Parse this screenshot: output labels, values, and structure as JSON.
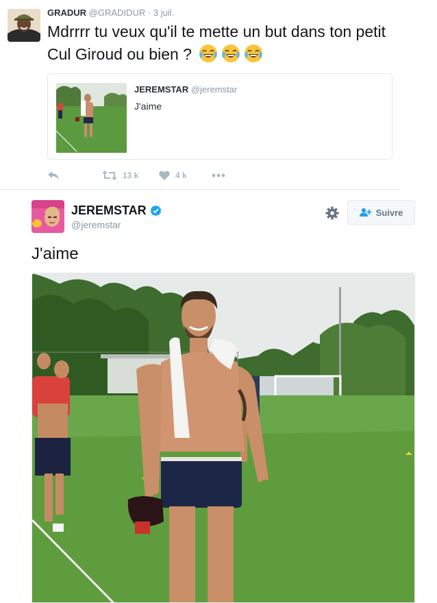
{
  "tweet": {
    "author_name": "GRADUR",
    "author_handle": "@GRADIDUR",
    "separator": "·",
    "time": "3 juil.",
    "text": "Mdrrrr tu veux qu'il te mette un but dans ton petit Cul Giroud ou bien ?",
    "emoji": [
      "face-with-tears-of-joy",
      "face-with-tears-of-joy",
      "face-with-tears-of-joy"
    ],
    "quoted": {
      "author_name": "JEREMSTAR",
      "author_handle": "@jeremstar",
      "text": "J'aime"
    },
    "actions": {
      "reply_icon": "reply-icon",
      "retweet_icon": "retweet-icon",
      "retweet_count": "13 k",
      "like_icon": "heart-icon",
      "like_count": "4 k",
      "more_icon": "more-icon"
    }
  },
  "main_tweet": {
    "author_name": "JEREMSTAR",
    "author_handle": "@jeremstar",
    "verified_icon": "verified-badge-icon",
    "follow_label": "Suivre",
    "gear_icon": "gear-icon",
    "text": "J'aime"
  },
  "colors": {
    "text": "#14171a",
    "muted": "#8899a6",
    "verified": "#1da1f2",
    "border": "#e1e8ed",
    "icon": "#aab8c2"
  }
}
